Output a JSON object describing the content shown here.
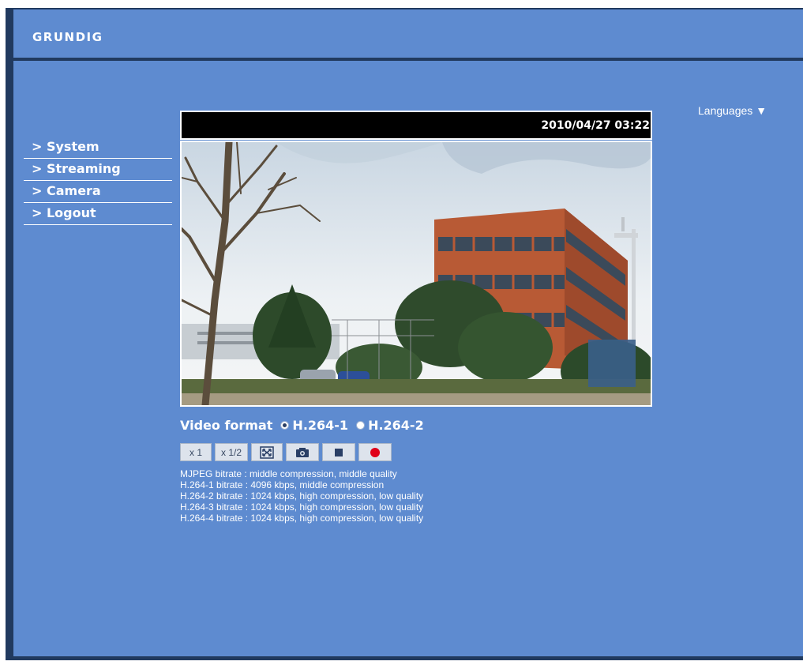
{
  "header": {
    "logo_text": "GRUNDIG"
  },
  "languages": {
    "label": "Languages",
    "arrow": "▼"
  },
  "nav": {
    "items": [
      "> System",
      "> Streaming",
      "> Camera",
      "> Logout"
    ]
  },
  "video": {
    "timestamp": "2010/04/27 03:22"
  },
  "video_format": {
    "label": "Video format",
    "options": [
      {
        "label": "H.264-1",
        "selected": true
      },
      {
        "label": "H.264-2",
        "selected": false
      }
    ]
  },
  "controls": {
    "zoom_x1": "x 1",
    "zoom_half": "x 1/2",
    "fullscreen_icon": "fullscreen-icon",
    "snapshot_icon": "camera-icon",
    "stop_icon": "stop-icon",
    "record_icon": "record-icon",
    "record_color": "#e0001a"
  },
  "bitrates": [
    "MJPEG bitrate : middle compression, middle quality",
    "H.264-1 bitrate : 4096 kbps, middle compression",
    "H.264-2 bitrate : 1024 kbps, high compression, low quality",
    "H.264-3 bitrate : 1024 kbps, high compression, low quality",
    "H.264-4 bitrate : 1024 kbps, high compression, low quality"
  ],
  "colors": {
    "background": "#5e8bd0",
    "frame": "#213a5f",
    "text": "#ffffff"
  }
}
